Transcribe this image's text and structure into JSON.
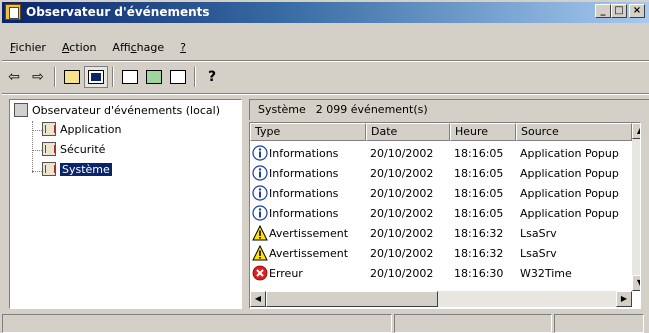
{
  "window": {
    "title": "Observateur d'événements",
    "btn_min": "_",
    "btn_max": "□",
    "btn_close": "×"
  },
  "menu": [
    {
      "label": "Fichier",
      "accel": "F",
      "rest": "ichier"
    },
    {
      "label": "Action",
      "accel": "A",
      "rest": "ction"
    },
    {
      "label": "Affichage",
      "pre": "Affi",
      "accel": "c",
      "rest": "hage"
    },
    {
      "label": "?",
      "accel": "?",
      "rest": ""
    }
  ],
  "toolbar": {
    "back_glyph": "⇦",
    "forward_glyph": "⇨",
    "help_glyph": "?"
  },
  "tree": {
    "root": "Observateur d'événements (local)",
    "children": [
      "Application",
      "Sécurité",
      "Système"
    ],
    "selected": "Système"
  },
  "panel": {
    "log_name": "Système",
    "event_count": "2 099 événement(s)"
  },
  "list": {
    "columns": [
      "Type",
      "Date",
      "Heure",
      "Source"
    ],
    "rows": [
      {
        "type": "Informations",
        "level": "info",
        "date": "20/10/2002",
        "time": "18:16:05",
        "source": "Application Popup"
      },
      {
        "type": "Informations",
        "level": "info",
        "date": "20/10/2002",
        "time": "18:16:05",
        "source": "Application Popup"
      },
      {
        "type": "Informations",
        "level": "info",
        "date": "20/10/2002",
        "time": "18:16:05",
        "source": "Application Popup"
      },
      {
        "type": "Informations",
        "level": "info",
        "date": "20/10/2002",
        "time": "18:16:05",
        "source": "Application Popup"
      },
      {
        "type": "Avertissement",
        "level": "warning",
        "date": "20/10/2002",
        "time": "18:16:32",
        "source": "LsaSrv"
      },
      {
        "type": "Avertissement",
        "level": "warning",
        "date": "20/10/2002",
        "time": "18:16:32",
        "source": "LsaSrv"
      },
      {
        "type": "Erreur",
        "level": "error",
        "date": "20/10/2002",
        "time": "18:16:30",
        "source": "W32Time"
      }
    ]
  },
  "colors": {
    "title_gradient_start": "#0a246a",
    "title_gradient_end": "#a6caf0",
    "selection": "#0a246a",
    "face": "#d4d0c8"
  }
}
